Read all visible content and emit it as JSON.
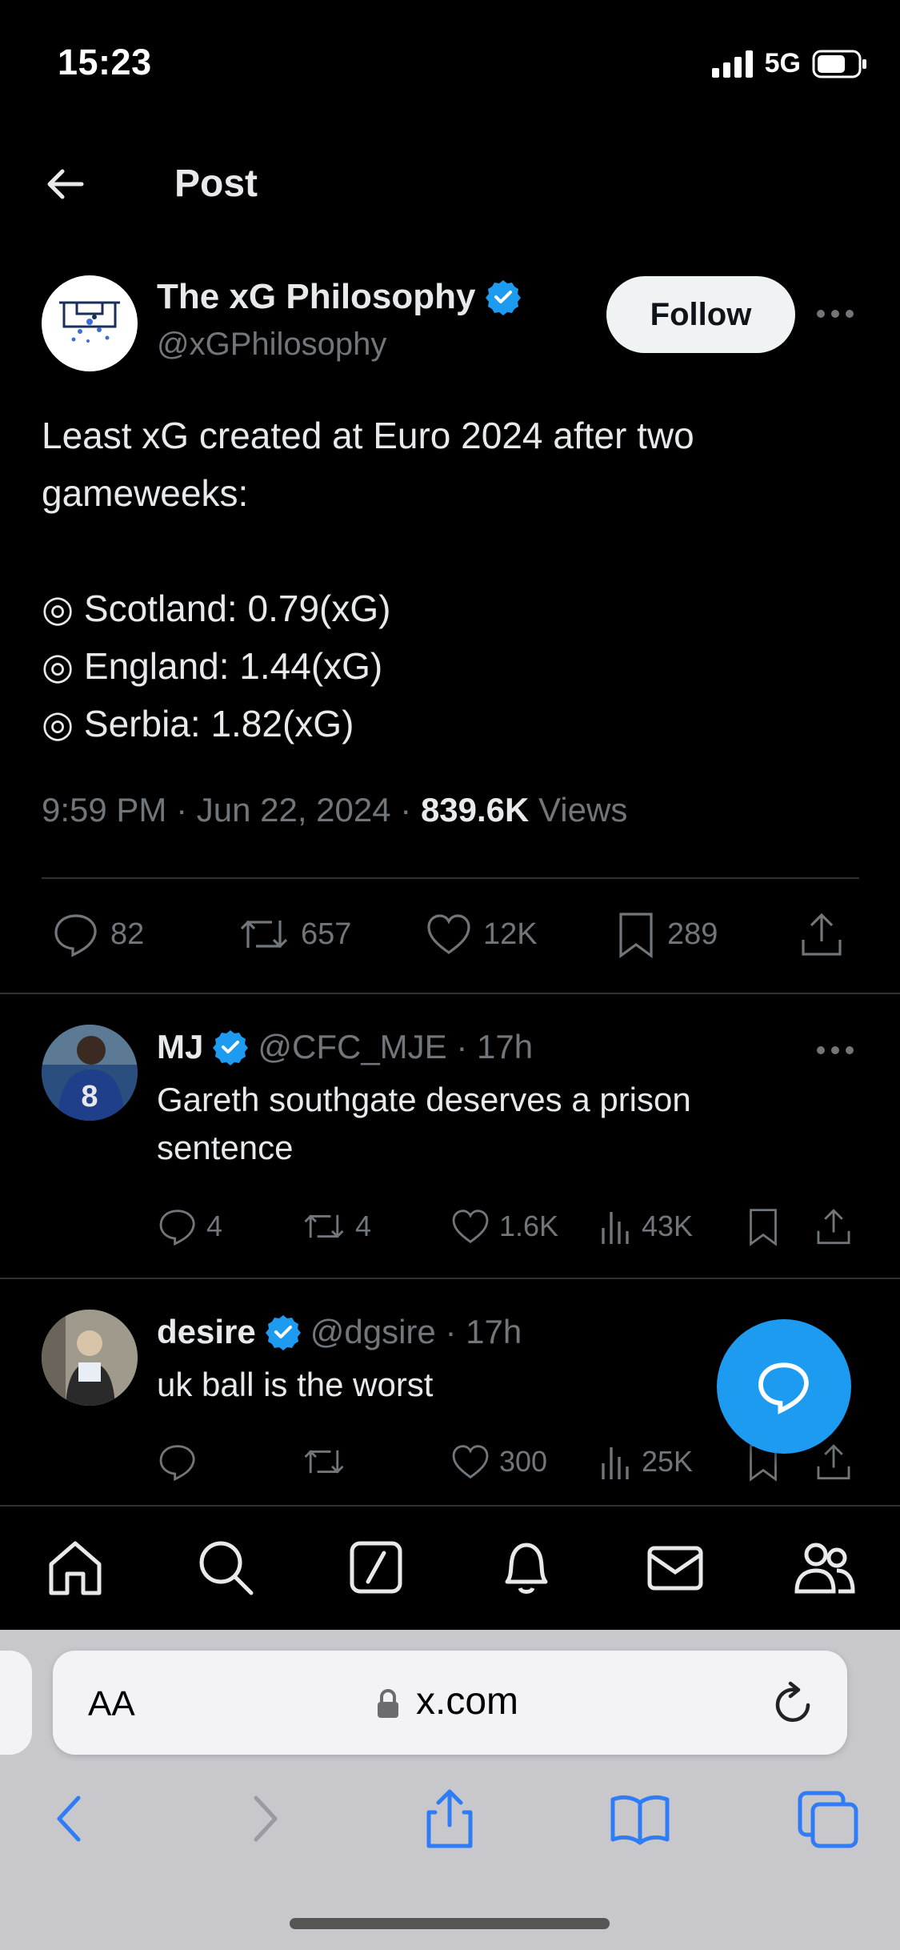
{
  "status": {
    "time": "15:23",
    "network": "5G"
  },
  "header": {
    "title": "Post"
  },
  "post": {
    "author": {
      "name": "The xG Philosophy",
      "handle": "@xGPhilosophy"
    },
    "follow_label": "Follow",
    "lines": [
      "Least xG created at Euro 2024 after two",
      "gameweeks:",
      "",
      "◎ Scotland: 0.79(xG)",
      "◎ England: 1.44(xG)",
      "◎ Serbia: 1.82(xG)"
    ],
    "meta": {
      "time_date": "9:59 PM · Jun 22, 2024 · ",
      "views_count": "839.6K",
      "views_label": " Views"
    },
    "actions": {
      "replies": "82",
      "reposts": "657",
      "likes": "12K",
      "bookmarks": "289"
    }
  },
  "replies": [
    {
      "name": "MJ",
      "handle": "@CFC_MJE · 17h",
      "text_lines": [
        "Gareth southgate deserves a prison",
        "sentence"
      ],
      "replies": "4",
      "reposts": "4",
      "likes": "1.6K",
      "views": "43K"
    },
    {
      "name": "desire",
      "handle": "@dgsire · 17h",
      "text_lines": [
        "uk ball is the worst"
      ],
      "replies": "",
      "reposts": "",
      "likes": "300",
      "views": "25K"
    }
  ],
  "safari": {
    "aa": "AA",
    "url": "x.com"
  },
  "colors": {
    "accent": "#1d9bf0",
    "background": "#000000",
    "muted": "#71767b"
  }
}
